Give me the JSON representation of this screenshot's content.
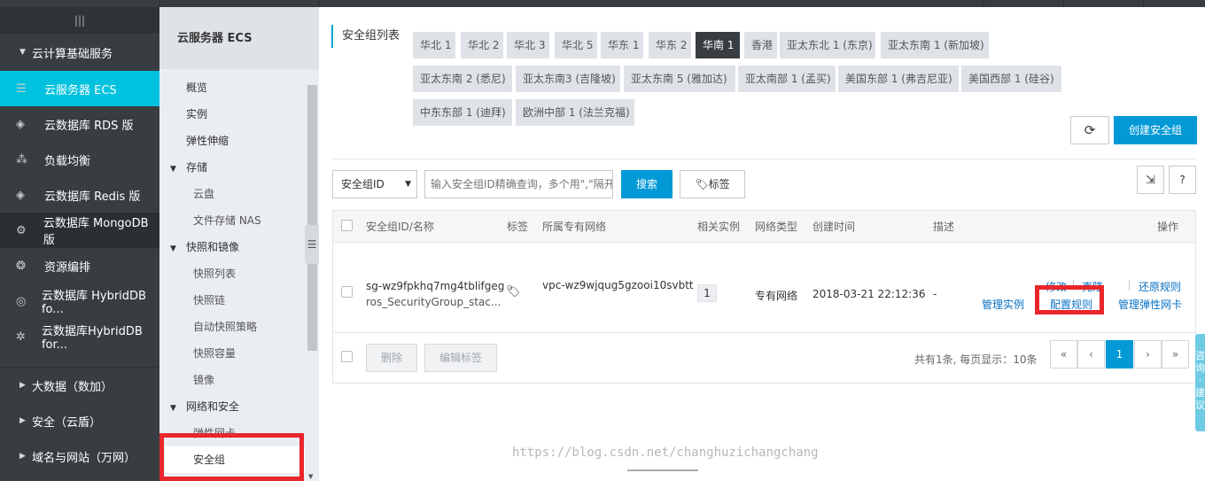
{
  "sidebar": {
    "toggle_icon": "menu-icon",
    "main_group": "云计算基础服务",
    "items": [
      {
        "label": "云服务器 ECS",
        "icon": "server-icon",
        "active": true
      },
      {
        "label": "云数据库 RDS 版",
        "icon": "database-icon"
      },
      {
        "label": "负载均衡",
        "icon": "load-balancer-icon"
      },
      {
        "label": "云数据库 Redis 版",
        "icon": "redis-icon"
      },
      {
        "label": "云数据库 MongoDB 版",
        "icon": "mongodb-icon",
        "hover": true
      },
      {
        "label": "资源编排",
        "icon": "orchestration-icon"
      },
      {
        "label": "云数据库 HybridDB fo...",
        "icon": "hybriddb-icon"
      },
      {
        "label": "云数据库HybridDB for...",
        "icon": "hybriddb2-icon"
      }
    ],
    "bottom_groups": [
      "大数据（数加）",
      "安全（云盾）",
      "域名与网站（万网）"
    ]
  },
  "subnav": {
    "title": "云服务器 ECS",
    "items": [
      {
        "label": "概览",
        "level": 1
      },
      {
        "label": "实例",
        "level": 1
      },
      {
        "label": "弹性伸缩",
        "level": 1
      },
      {
        "label": "存储",
        "level": 0
      },
      {
        "label": "云盘",
        "level": 2
      },
      {
        "label": "文件存储 NAS",
        "level": 2
      },
      {
        "label": "快照和镜像",
        "level": 0
      },
      {
        "label": "快照列表",
        "level": 2
      },
      {
        "label": "快照链",
        "level": 2
      },
      {
        "label": "自动快照策略",
        "level": 2
      },
      {
        "label": "快照容量",
        "level": 2
      },
      {
        "label": "镜像",
        "level": 2
      },
      {
        "label": "网络和安全",
        "level": 0
      },
      {
        "label": "弹性网卡",
        "level": 2
      },
      {
        "label": "安全组",
        "level": 2,
        "selected": true
      }
    ]
  },
  "main": {
    "section_label": "安全组列表",
    "regions": [
      "华北 1",
      "华北 2",
      "华北 3",
      "华北 5",
      "华东 1",
      "华东 2",
      "华南 1",
      "香港",
      "亚太东北 1 (东京)",
      "亚太东南 1 (新加坡)",
      "亚太东南 2 (悉尼)",
      "亚太东南3 (吉隆坡)",
      "亚太东南 5 (雅加达)",
      "亚太南部 1 (孟买)",
      "美国东部 1 (弗吉尼亚)",
      "美国西部 1 (硅谷)",
      "中东东部 1 (迪拜)",
      "欧洲中部 1 (法兰克福)"
    ],
    "active_region": "华南 1",
    "refresh_icon": "refresh-icon",
    "create_button": "创建安全组",
    "filter_select": "安全组ID",
    "search_placeholder": "输入安全组ID精确查询，多个用\",\"隔开",
    "search_button": "搜索",
    "tag_button": "标签",
    "export_icon": "export-icon",
    "help_label": "?",
    "table": {
      "headers": [
        "安全组ID/名称",
        "标签",
        "所属专有网络",
        "相关实例",
        "网络类型",
        "创建时间",
        "描述",
        "操作"
      ],
      "row": {
        "id": "sg-wz9fpkhq7mg4tblifgeg",
        "name": "ros_SecurityGroup_stac...",
        "vpc": "vpc-wz9wjqug5gzooi10svbtt",
        "instances": "1",
        "network_type": "专有网络",
        "created": "2018-03-21 22:12:36",
        "desc": "-",
        "actions_row1": [
          "修改",
          "克隆",
          "还原规则"
        ],
        "actions_row2": [
          "管理实例",
          "配置规则",
          "管理弹性网卡"
        ]
      }
    },
    "footer": {
      "delete_button": "删除",
      "edit_tags_button": "编辑标签",
      "summary": "共有1条, 每页显示：10条",
      "pager": [
        "«",
        "‹",
        "1",
        "›",
        "»"
      ]
    },
    "side_tab": "咨询·建议",
    "watermark": "https://blog.csdn.net/changhuzichangchang"
  }
}
